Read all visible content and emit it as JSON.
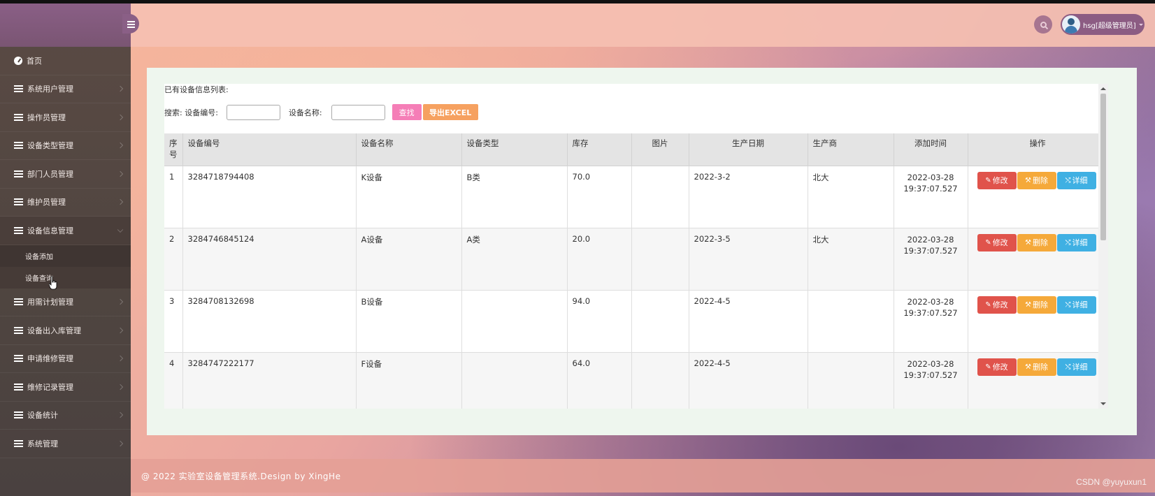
{
  "topbar": {
    "user_name": "hsg[超级管理员]"
  },
  "sidebar": {
    "items": [
      {
        "label": "首页",
        "icon": "dashboard-icon"
      },
      {
        "label": "系统用户管理",
        "icon": "list-icon"
      },
      {
        "label": "操作员管理",
        "icon": "list-icon"
      },
      {
        "label": "设备类型管理",
        "icon": "list-icon"
      },
      {
        "label": "部门人员管理",
        "icon": "list-icon"
      },
      {
        "label": "维护员管理",
        "icon": "list-icon"
      },
      {
        "label": "设备信息管理",
        "icon": "list-icon",
        "expanded": true,
        "children": [
          "设备添加",
          "设备查询"
        ],
        "active_child": "设备查询"
      },
      {
        "label": "用需计划管理",
        "icon": "list-icon"
      },
      {
        "label": "设备出入库管理",
        "icon": "list-icon"
      },
      {
        "label": "申请维修管理",
        "icon": "list-icon"
      },
      {
        "label": "维修记录管理",
        "icon": "list-icon"
      },
      {
        "label": "设备统计",
        "icon": "list-icon"
      },
      {
        "label": "系统管理",
        "icon": "list-icon"
      }
    ]
  },
  "content": {
    "heading": "已有设备信息列表:",
    "search": {
      "prefix": "搜索: 设备编号:",
      "name_label": "设备名称:",
      "code_value": "",
      "name_value": "",
      "search_button": "查找",
      "export_button": "导出EXCEL"
    },
    "table": {
      "headers": [
        "序号",
        "设备编号",
        "设备名称",
        "设备类型",
        "库存",
        "图片",
        "生产日期",
        "生产商",
        "添加时间",
        "操作"
      ],
      "rows": [
        {
          "no": "1",
          "code": "3284718794408",
          "name": "K设备",
          "type": "B类",
          "stock": "70.0",
          "image": "",
          "date": "2022-3-2",
          "maker": "北大",
          "added_date": "2022-03-28",
          "added_time": "19:37:07.527"
        },
        {
          "no": "2",
          "code": "3284746845124",
          "name": "A设备",
          "type": "A类",
          "stock": "20.0",
          "image": "",
          "date": "2022-3-5",
          "maker": "北大",
          "added_date": "2022-03-28",
          "added_time": "19:37:07.527"
        },
        {
          "no": "3",
          "code": "3284708132698",
          "name": "B设备",
          "type": "",
          "stock": "94.0",
          "image": "",
          "date": "2022-4-5",
          "maker": "",
          "added_date": "2022-03-28",
          "added_time": "19:37:07.527"
        },
        {
          "no": "4",
          "code": "3284747222177",
          "name": "F设备",
          "type": "",
          "stock": "64.0",
          "image": "",
          "date": "2022-4-5",
          "maker": "",
          "added_date": "2022-03-28",
          "added_time": "19:37:07.527"
        }
      ],
      "actions": {
        "edit": "修改",
        "delete": "删除",
        "detail": "详细"
      }
    }
  },
  "footer": {
    "text": "@ 2022 实验室设备管理系统.Design by XingHe"
  },
  "watermark": "CSDN @yuyuxun1",
  "colors": {
    "brand": "#8a5f86",
    "sidebar_bg": "#4f4540",
    "btn_search": "#f57eb7",
    "btn_export": "#f6a160",
    "btn_edit": "#e0534b",
    "btn_delete": "#f5a93a",
    "btn_detail": "#3fb0e3"
  }
}
